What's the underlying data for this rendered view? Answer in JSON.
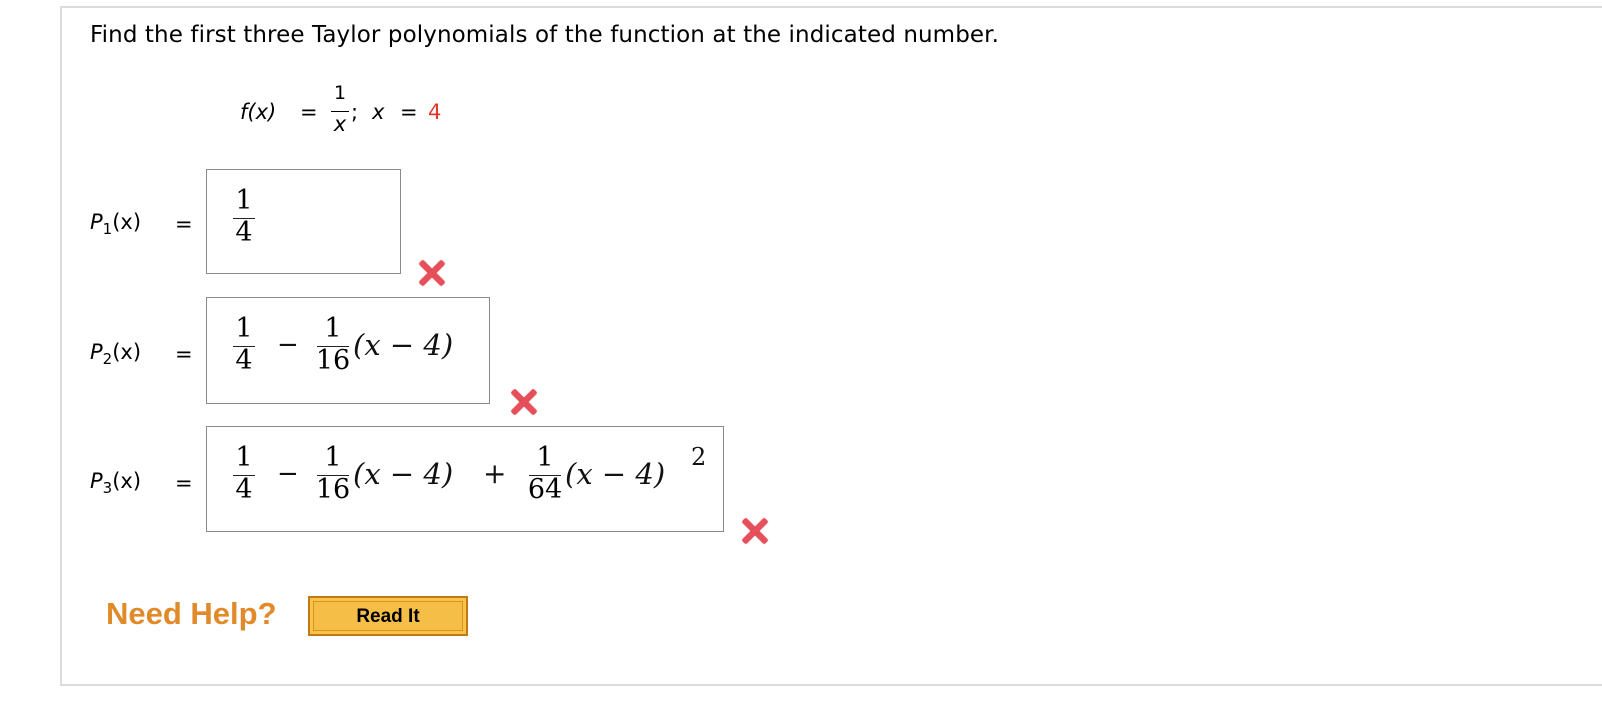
{
  "question": {
    "text": "Find the first three Taylor polynomials of the function at the indicated number."
  },
  "function_def": {
    "lhs": "f(x)",
    "equals": "=",
    "numerator": "1",
    "denominator": "x",
    "separator": ";",
    "var": "x",
    "point_equals": "=",
    "point_value": "4"
  },
  "answers": [
    {
      "label_main": "P",
      "label_sub": "1",
      "label_arg": "(x)",
      "equals": "=",
      "terms": {
        "f1n": "1",
        "f1d": "4"
      },
      "correct": false
    },
    {
      "label_main": "P",
      "label_sub": "2",
      "label_arg": "(x)",
      "equals": "=",
      "terms": {
        "f1n": "1",
        "f1d": "4",
        "op1": "−",
        "f2n": "1",
        "f2d": "16",
        "paren1": "(x − 4)"
      },
      "correct": false
    },
    {
      "label_main": "P",
      "label_sub": "3",
      "label_arg": "(x)",
      "equals": "=",
      "terms": {
        "f1n": "1",
        "f1d": "4",
        "op1": "−",
        "f2n": "1",
        "f2d": "16",
        "paren1": "(x − 4)",
        "op2": "+",
        "f3n": "1",
        "f3d": "64",
        "paren2": "(x − 4)",
        "exp": "2"
      },
      "correct": false
    }
  ],
  "help": {
    "label": "Need Help?",
    "read_it_button": "Read It"
  },
  "colors": {
    "accent_red": "#e03a2f",
    "help_orange": "#e08a2a",
    "button_fill": "#f4be47",
    "wrong_mark": "#e7505a"
  }
}
